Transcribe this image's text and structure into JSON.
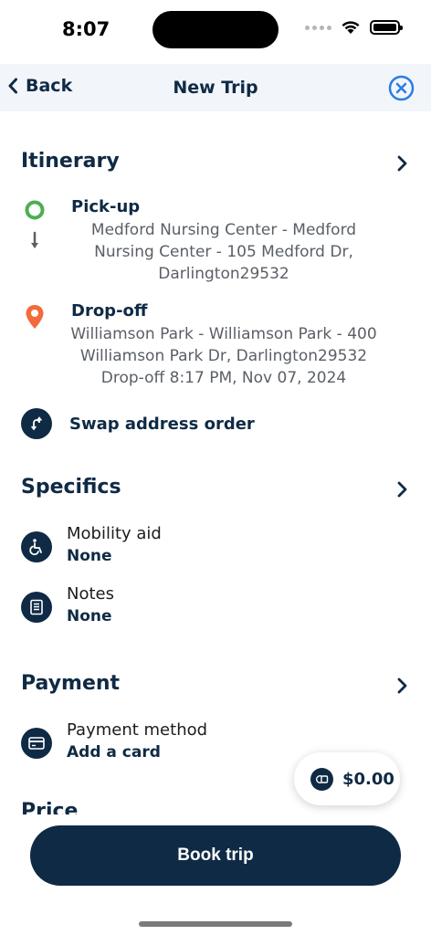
{
  "status_bar": {
    "time": "8:07"
  },
  "nav": {
    "back_label": "Back",
    "title": "New Trip"
  },
  "itinerary": {
    "title": "Itinerary",
    "pickup": {
      "label": "Pick-up",
      "address_line1": "Medford Nursing Center - Medford",
      "address_line2": "Nursing Center - 105 Medford Dr,",
      "address_line3": "Darlington29532"
    },
    "dropoff": {
      "label": "Drop-off",
      "address_line1": "Williamson Park - Williamson Park - 400",
      "address_line2": "Williamson Park Dr, Darlington29532",
      "time_line": "Drop-off 8:17 PM, Nov 07, 2024"
    },
    "swap_label": "Swap address order"
  },
  "specifics": {
    "title": "Specifics",
    "mobility_aid": {
      "label": "Mobility aid",
      "value": "None"
    },
    "notes": {
      "label": "Notes",
      "value": "None"
    }
  },
  "payment": {
    "title": "Payment",
    "method": {
      "label": "Payment method",
      "value": "Add a card"
    },
    "next_section_partial": "Price"
  },
  "price_pill": {
    "amount": "$0.00"
  },
  "book_button": {
    "label": "Book trip"
  },
  "colors": {
    "primary": "#0f2a45",
    "pickup": "#4caf50",
    "dropoff": "#f26b3a",
    "close": "#2a7de1"
  }
}
